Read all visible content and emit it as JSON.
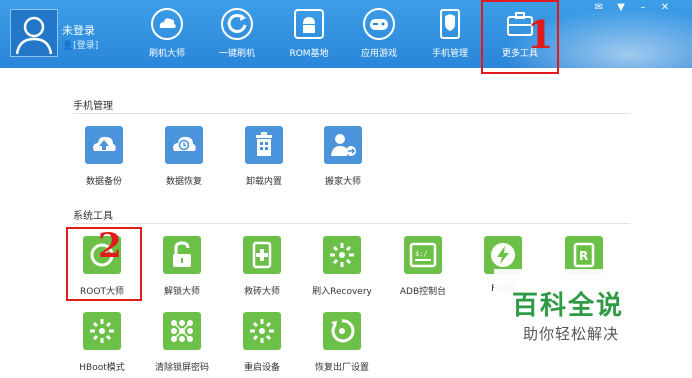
{
  "user": {
    "name": "未登录",
    "login_link": "[登录]"
  },
  "nav": [
    {
      "label": "刷机大师",
      "icon": "cloud-icon"
    },
    {
      "label": "一键刷机",
      "icon": "refresh-icon"
    },
    {
      "label": "ROM基地",
      "icon": "android-icon"
    },
    {
      "label": "应用游戏",
      "icon": "gamepad-icon"
    },
    {
      "label": "手机管理",
      "icon": "shield-icon"
    },
    {
      "label": "更多工具",
      "icon": "toolbox-icon"
    }
  ],
  "sections": {
    "phone": {
      "title": "手机管理",
      "items": [
        {
          "label": "数据备份",
          "icon": "cloud-upload-icon"
        },
        {
          "label": "数据恢复",
          "icon": "cloud-clock-icon"
        },
        {
          "label": "卸载内置",
          "icon": "trash-icon"
        },
        {
          "label": "搬家大师",
          "icon": "person-move-icon"
        }
      ]
    },
    "system": {
      "title": "系统工具",
      "items": [
        {
          "label": "ROOT大师",
          "icon": "root-icon"
        },
        {
          "label": "解锁大师",
          "icon": "unlock-icon"
        },
        {
          "label": "救砖大师",
          "icon": "rescue-icon"
        },
        {
          "label": "刷入Recovery",
          "icon": "sun-icon"
        },
        {
          "label": "ADB控制台",
          "icon": "terminal-icon"
        },
        {
          "label": "Fastb",
          "icon": "bolt-icon"
        },
        {
          "label": "",
          "icon": "r-box-icon"
        },
        {
          "label": "HBoot模式",
          "icon": "sun-icon"
        },
        {
          "label": "清除锁屏密码",
          "icon": "grid-icon"
        },
        {
          "label": "重启设备",
          "icon": "sun-icon"
        },
        {
          "label": "恢复出厂设置",
          "icon": "reset-icon"
        }
      ]
    }
  },
  "annotations": {
    "mark1": "1",
    "mark2": "2"
  },
  "watermark": {
    "main": "百科全说",
    "sub": "助你轻松解决"
  },
  "colors": {
    "topbar": "#2a86d9",
    "tile_blue": "#4b93db",
    "tile_green": "#6cc047",
    "annotation_red": "#e11b1b",
    "watermark_green": "#2e9a44"
  }
}
